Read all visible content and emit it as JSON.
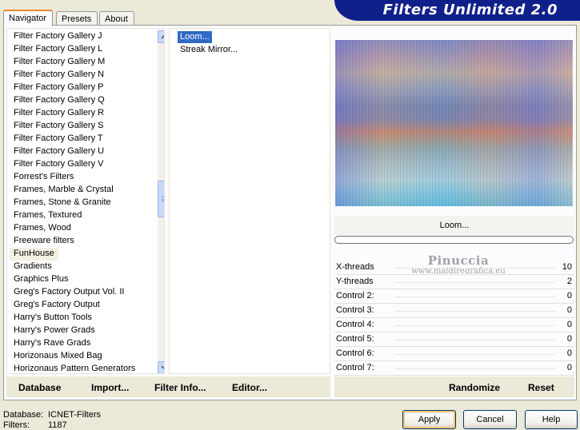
{
  "banner": {
    "title": "Filters Unlimited 2.0"
  },
  "tabs": [
    {
      "label": "Navigator",
      "active": true
    },
    {
      "label": "Presets",
      "active": false
    },
    {
      "label": "About",
      "active": false
    }
  ],
  "categories": {
    "items": [
      "Filter Factory Gallery J",
      "Filter Factory Gallery L",
      "Filter Factory Gallery M",
      "Filter Factory Gallery N",
      "Filter Factory Gallery P",
      "Filter Factory Gallery Q",
      "Filter Factory Gallery R",
      "Filter Factory Gallery S",
      "Filter Factory Gallery T",
      "Filter Factory Gallery U",
      "Filter Factory Gallery V",
      "Forrest's Filters",
      "Frames, Marble & Crystal",
      "Frames, Stone & Granite",
      "Frames, Textured",
      "Frames, Wood",
      "Freeware filters",
      "FunHouse",
      "Gradients",
      "Graphics Plus",
      "Greg's Factory Output Vol. II",
      "Greg's Factory Output",
      "Harry's Button Tools",
      "Harry's Power Grads",
      "Harry's Rave Grads",
      "Horizonaus Mixed Bag",
      "Horizonaus Pattern Generators"
    ],
    "selected": "FunHouse",
    "scroll_position": 0.49
  },
  "filters": {
    "items": [
      "Loom...",
      "Streak Mirror..."
    ],
    "selected": "Loom..."
  },
  "preview": {
    "filter_name": "Loom..."
  },
  "watermark": {
    "name": "Pinuccia",
    "url": "www.maidiregrafica.eu"
  },
  "controls": [
    {
      "label": "X-threads",
      "value": "10"
    },
    {
      "label": "Y-threads",
      "value": "2"
    },
    {
      "label": "Control 2:",
      "value": "0"
    },
    {
      "label": "Control 3:",
      "value": "0"
    },
    {
      "label": "Control 4:",
      "value": "0"
    },
    {
      "label": "Control 5:",
      "value": "0"
    },
    {
      "label": "Control 6:",
      "value": "0"
    },
    {
      "label": "Control 7:",
      "value": "0"
    }
  ],
  "left_actions": {
    "database": "Database",
    "import": "Import...",
    "filter_info": "Filter Info...",
    "editor": "Editor..."
  },
  "right_actions": {
    "randomize": "Randomize",
    "reset": "Reset"
  },
  "status": {
    "database_label": "Database:",
    "database_value": "ICNET-Filters",
    "filters_label": "Filters:",
    "filters_value": "1187"
  },
  "dialog_buttons": {
    "apply": "Apply",
    "cancel": "Cancel",
    "help": "Help"
  }
}
